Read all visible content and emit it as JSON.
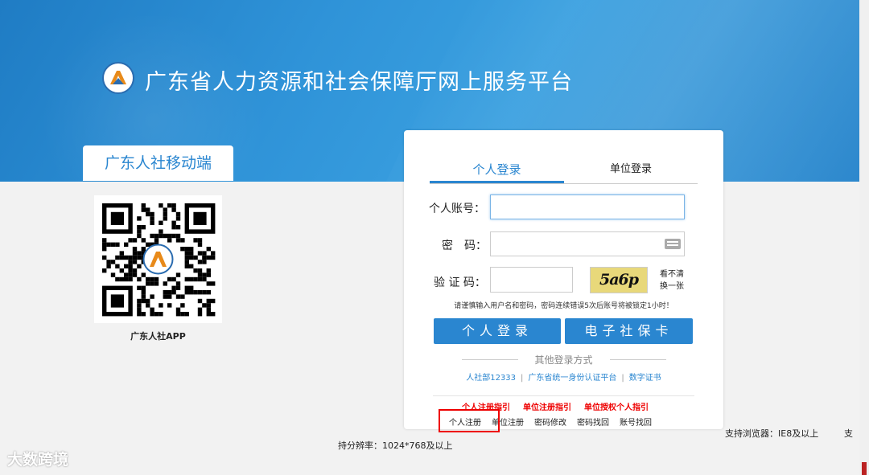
{
  "header": {
    "title": "广东省人力资源和社会保障厅网上服务平台"
  },
  "mobile": {
    "tab_label": "广东人社移动端",
    "qr_caption": "广东人社APP"
  },
  "login": {
    "tab_personal": "个人登录",
    "tab_unit": "单位登录",
    "account_label": "个人账号：",
    "password_label": "密　码：",
    "captcha_label": "验 证 码：",
    "captcha_text": "5a6p",
    "captcha_refresh": "看不清换一张",
    "warning": "请谨慎输入用户名和密码，密码连续错误5次后账号将被锁定1小时！",
    "login_button": "个人登录",
    "ecard_button": "电子社保卡",
    "other_methods": "其他登录方式",
    "alt_links": [
      "人社部12333",
      "广东省统一身份认证平台",
      "数字证书"
    ],
    "guides": [
      "个人注册指引",
      "单位注册指引",
      "单位授权个人指引"
    ],
    "bottom_links": [
      "个人注册",
      "单位注册",
      "密码修改",
      "密码找回",
      "账号找回"
    ]
  },
  "footer": {
    "resolution": "持分辨率：1024*768及以上",
    "browser": "支持浏览器：IE8及以上",
    "truncated": "支"
  },
  "watermark": "大数跨境",
  "colors": {
    "brand_blue": "#2a86d0",
    "guide_red": "#e00000"
  }
}
